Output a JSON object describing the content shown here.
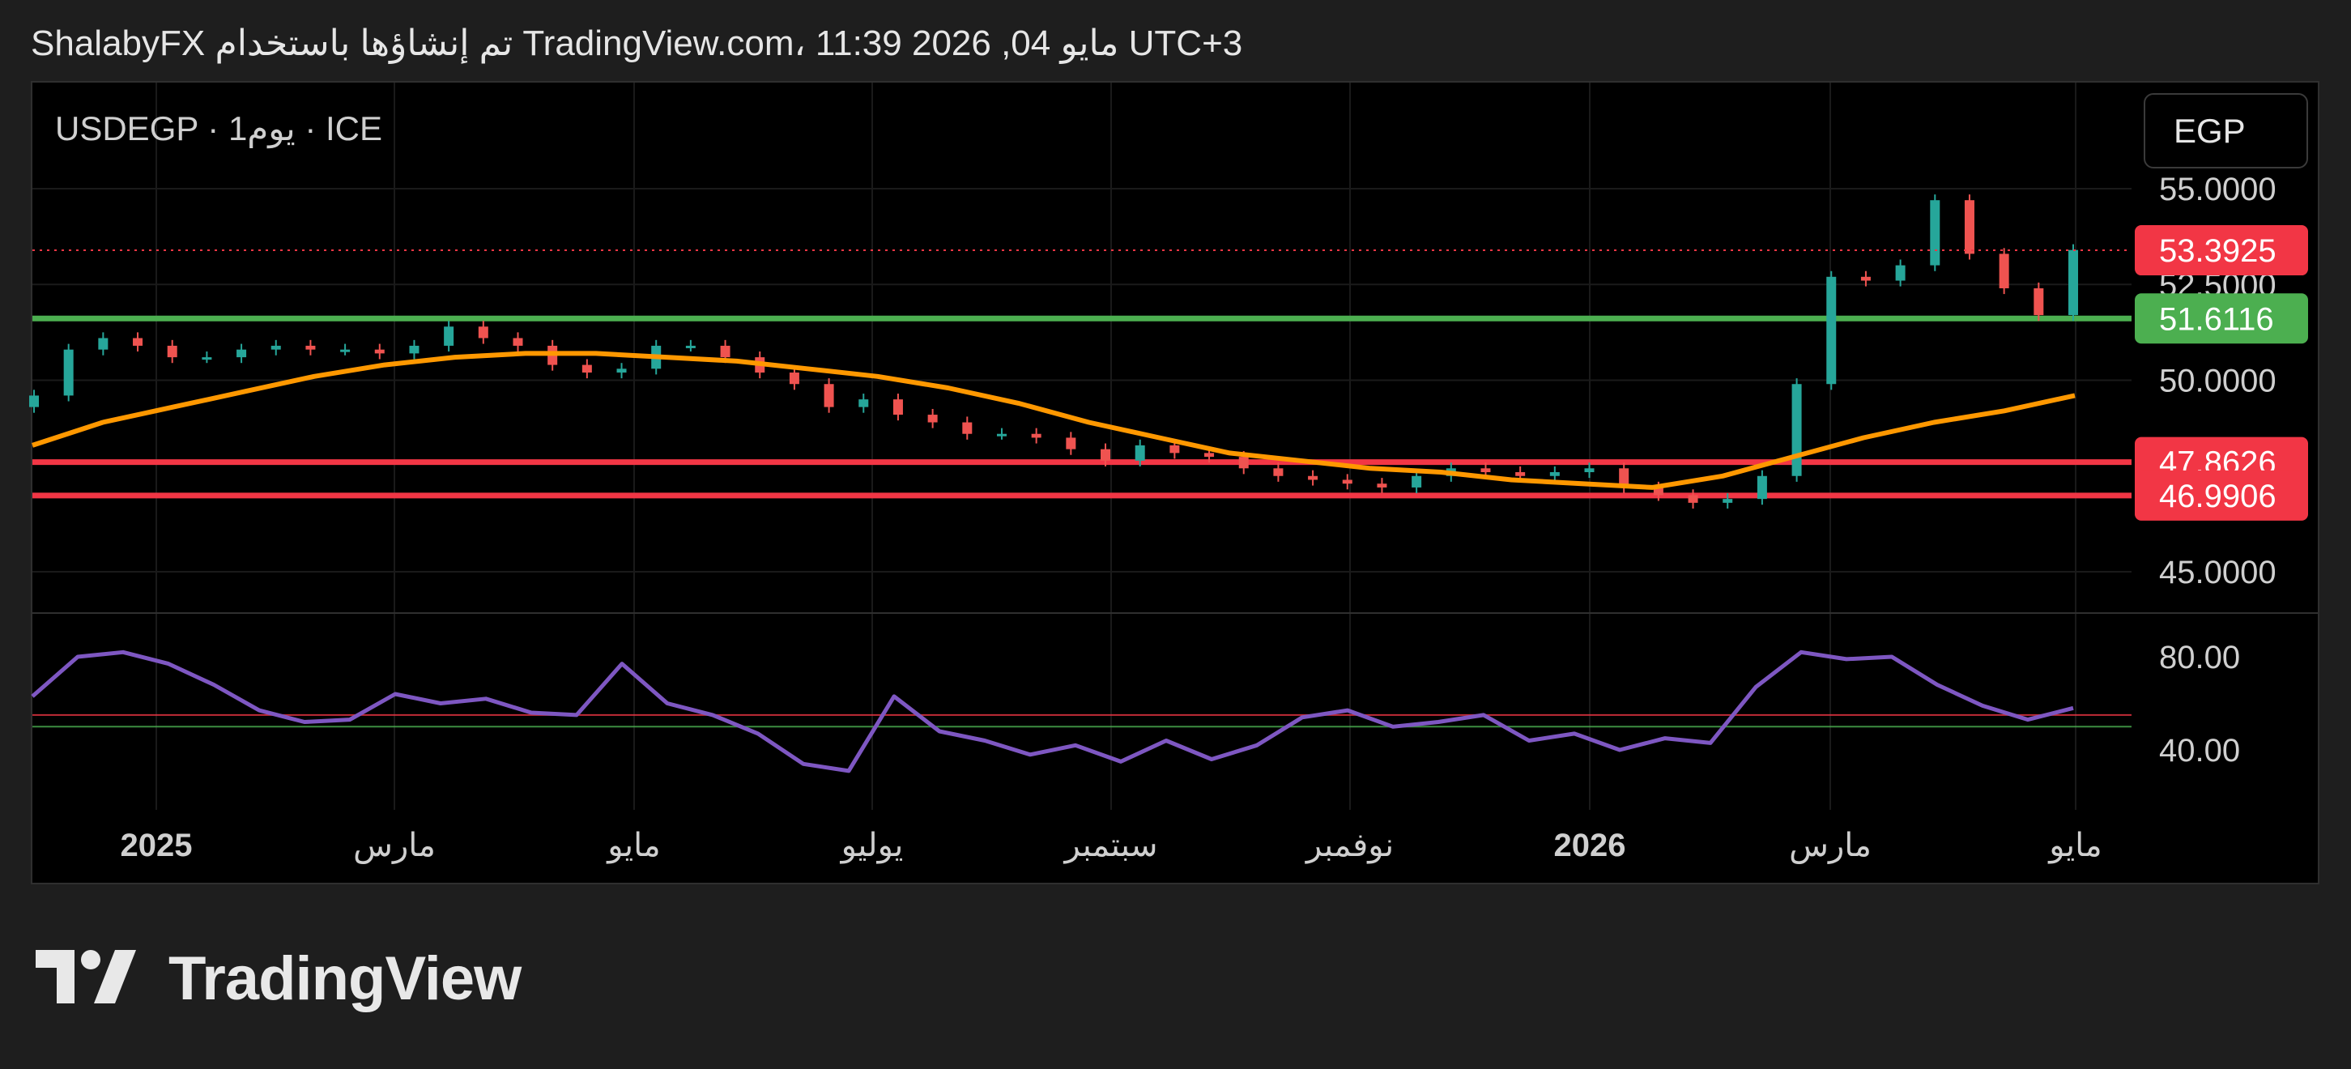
{
  "header": {
    "caption": "ShalabyFX تم إنشاؤها باستخدام TradingView.com، 11:39 2026 ,04 مايو UTC+3"
  },
  "toolbar": {
    "symbol_label": "USDEGP · 1يوم · ICE",
    "currency_label": "EGP"
  },
  "brand": {
    "name": "TradingView"
  },
  "colors": {
    "background": "#000000",
    "page": "#1e1e1e",
    "up": "#26a69a",
    "down": "#ef5350",
    "ma": "#ff9800",
    "rsi": "#7e57c2",
    "support_green": "#4caf50",
    "resistance_red": "#f23645"
  },
  "chart_data": {
    "type": "candlestick",
    "symbol": "USDEGP",
    "interval": "1يوم",
    "source": "ICE",
    "currency": "EGP",
    "price_axis": {
      "ticks": [
        "55.0000",
        "52.5000",
        "50.0000",
        "45.0000"
      ],
      "tick_values": [
        55.0,
        52.5,
        50.0,
        45.0
      ],
      "ylim": [
        44.0,
        56.0
      ]
    },
    "time_axis": {
      "labels": [
        "2025",
        "مارس",
        "مايو",
        "يوليو",
        "سبتمبر",
        "نوفمبر",
        "2026",
        "مارس",
        "مايو"
      ],
      "bold": [
        true,
        false,
        false,
        false,
        false,
        false,
        true,
        false,
        false
      ]
    },
    "price_labels": [
      {
        "value": "53.3925",
        "price": 53.3925,
        "color": "#f23645",
        "kind": "last-price"
      },
      {
        "value": "51.6116",
        "price": 51.6116,
        "color": "#4caf50",
        "kind": "support-line"
      },
      {
        "value": "47.8626",
        "price": 47.8626,
        "color": "#f23645",
        "kind": "resistance-line"
      },
      {
        "value": "46.9906",
        "price": 46.9906,
        "color": "#f23645",
        "kind": "resistance-line"
      }
    ],
    "close_series": [
      49.6,
      50.8,
      51.1,
      50.9,
      50.6,
      50.6,
      50.8,
      50.9,
      50.8,
      50.8,
      50.7,
      50.9,
      51.4,
      51.1,
      50.9,
      50.4,
      50.2,
      50.3,
      50.9,
      50.9,
      50.6,
      50.2,
      49.9,
      49.3,
      49.5,
      49.1,
      48.9,
      48.6,
      48.6,
      48.5,
      48.2,
      47.9,
      48.3,
      48.1,
      48.0,
      47.7,
      47.5,
      47.4,
      47.3,
      47.2,
      47.5,
      47.7,
      47.6,
      47.5,
      47.6,
      47.7,
      47.2,
      47.0,
      46.8,
      46.9,
      47.5,
      49.9,
      52.7,
      52.6,
      53.0,
      54.7,
      53.3,
      52.4,
      51.7,
      53.4
    ],
    "ma_series": [
      48.3,
      48.9,
      49.3,
      49.7,
      50.1,
      50.4,
      50.6,
      50.7,
      50.7,
      50.6,
      50.5,
      50.3,
      50.1,
      49.8,
      49.4,
      48.9,
      48.5,
      48.1,
      47.9,
      47.7,
      47.6,
      47.4,
      47.3,
      47.2,
      47.5,
      48.0,
      48.5,
      48.9,
      49.2,
      49.6
    ],
    "rsi": {
      "ticks": [
        "80.00",
        "40.00"
      ],
      "tick_values": [
        80,
        40
      ],
      "levels": [
        55,
        50
      ],
      "ylim": [
        20,
        95
      ],
      "values": [
        63,
        80,
        82,
        77,
        68,
        57,
        52,
        53,
        64,
        60,
        62,
        56,
        55,
        77,
        60,
        55,
        47,
        34,
        31,
        63,
        48,
        44,
        38,
        42,
        35,
        44,
        36,
        42,
        54,
        57,
        50,
        52,
        55,
        44,
        47,
        40,
        45,
        43,
        67,
        82,
        79,
        80,
        68,
        59,
        53,
        58
      ]
    }
  }
}
